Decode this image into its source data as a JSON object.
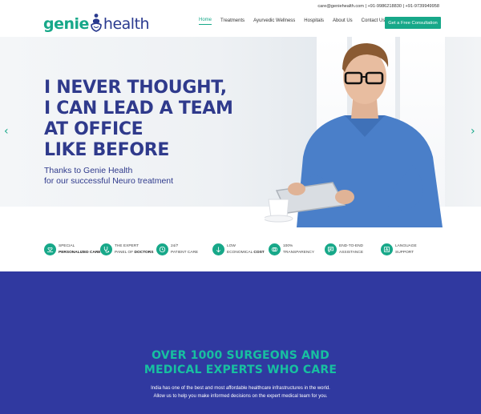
{
  "topbar": {
    "email": "care@geniehealth.com",
    "phone1": "+91-9986218830",
    "phone2": "+91-9739949958",
    "separator": " | "
  },
  "logo": {
    "part1": "genie",
    "part2": "health"
  },
  "nav": {
    "items": [
      "Home",
      "Treatments",
      "Ayurvedic Wellness",
      "Hospitals",
      "About Us",
      "Contact Us"
    ],
    "active": "Home",
    "cta": "Get a Free Consultation"
  },
  "hero": {
    "headline": [
      "I NEVER THOUGHT,",
      "I CAN LEAD A TEAM",
      "AT OFFICE",
      "LIKE BEFORE"
    ],
    "subline": [
      "Thanks to Genie Health",
      "for our successful Neuro treatment"
    ],
    "prev_arrow": "‹",
    "next_arrow": "›"
  },
  "features": [
    {
      "line1": "Special",
      "line2": "Personalized Care",
      "icon": "hand-heart-icon"
    },
    {
      "line1": "The Expert",
      "line2a": "Panel of ",
      "line2b": "Doctors",
      "icon": "stethoscope-icon"
    },
    {
      "line1": "24/7",
      "line2": "Patient Care",
      "icon": "clock-icon"
    },
    {
      "line1": "Low",
      "line2a": "Economical ",
      "line2b": "Cost",
      "icon": "coin-icon"
    },
    {
      "line1": "100%",
      "line2": "Transparency",
      "icon": "circles-icon"
    },
    {
      "line1": "End-to-End",
      "line2": "Assistance",
      "icon": "chat-icon"
    },
    {
      "line1": "Language",
      "line2": "Support",
      "icon": "translate-icon"
    }
  ],
  "section": {
    "title": [
      "OVER 1000 SURGEONS AND",
      "MEDICAL EXPERTS WHO CARE"
    ],
    "body": [
      "India has one of the best and most affordable healthcare infrastructures in the world.",
      "Allow us to help you make informed decisions on the expert medical team for you."
    ]
  },
  "colors": {
    "teal": "#17a889",
    "navy": "#2f3a8c",
    "band": "#3039a0"
  }
}
